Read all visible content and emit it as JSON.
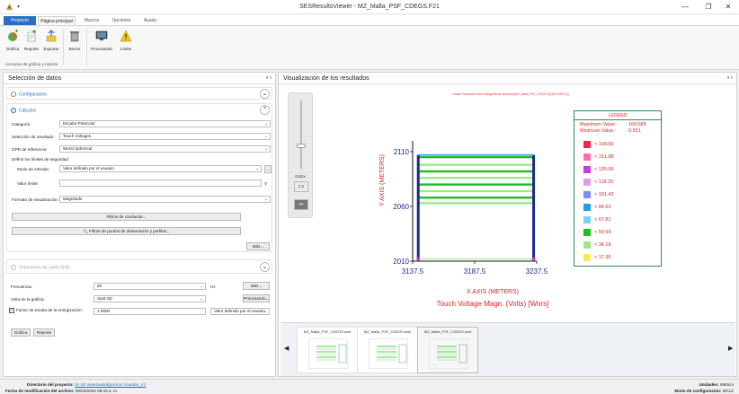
{
  "window": {
    "title": "SESResultsViewer - MZ_Malla_PSF_CDEGS.F21",
    "qa_label": "▾",
    "min": "—",
    "max": "❐",
    "close": "✕"
  },
  "tabs": [
    "Proyecto",
    "Página principal",
    "Macros",
    "Opciones",
    "Ayuda"
  ],
  "ribbon": {
    "buttons": [
      "Gráfica",
      "Reporte",
      "Exportar",
      "Borrar",
      "Procesando",
      "Límite"
    ],
    "group_label": "Acciones de gráfica y reporte"
  },
  "left": {
    "title": "Selección de datos",
    "pin": "▾ ⫰",
    "config_label": "Configuración",
    "calc_label": "Cálculos",
    "categoria_label": "Categoría",
    "categoria_value": "Escalar Potencial",
    "resultado_label": "Selección de resultado:",
    "resultado_value": "Touch Voltages",
    "gpr_label": "GPR de referencia:",
    "gpr_value": "Worst Spherical",
    "limites_label": "Definir los límites de seguridad",
    "modo_label": "Modo de entrada:",
    "modo_value": "Valor definido por el usuario",
    "modo_btn": "...",
    "valor_label": "Valor límite:",
    "valor_unit": "V",
    "formato_label": "Formato de visualización:",
    "formato_value": "Magnitude",
    "filtro_cond": "Filtros de conductor...",
    "filtro_obs": "Filtros de puntos de observación y perfiles...",
    "mas1": "Más...",
    "volumen_label": "Volúmenes de suelo finito",
    "frecuencia_label": "Frecuencia:",
    "frecuencia_value": "60",
    "frecuencia_unit": "Hz",
    "mas2": "Más...",
    "vista_label": "Vista de la gráfica:",
    "vista_value": "Spot-2D",
    "procesando": "Procesando...",
    "factor_label": "Factor de escala de la energización:",
    "factor_value": "1.0000",
    "factor_combo": "Valor definido por el usuario",
    "grafica_btn": "Gráfica",
    "reporte_btn": "Reporte"
  },
  "right": {
    "title": "Visualización de los resultados",
    "pin": "▾ ⫰",
    "zoom_value": "0.61x",
    "btn_11": "1:1",
    "btn_fit": "Fit",
    "thumbs": [
      "MZ_Malla_PSF_CDEGS.wmf",
      "MZ_Malla_PSF_CDEGS.wmf",
      "MZ_Malla_PSF_CDEGS.wmf"
    ],
    "prev": "◀",
    "next": "▶"
  },
  "chart_data": {
    "type": "heatmap",
    "title": "Scalar Potentials/Touch Voltage/Worst Spherical [MZ_Malla_PSF_CDEGS @(100.0000 %)]",
    "xlabel": "X AXIS  (METERS)",
    "subtitle": "Touch Voltage Magn. (Volts) [Wors]",
    "ylabel": "Y AXIS  (METERS)",
    "xticks": [
      "3137.5",
      "3187.5",
      "3237.5"
    ],
    "yticks": [
      "2110",
      "2060",
      "2010"
    ],
    "xlim": [
      3137.5,
      3237.5
    ],
    "ylim": [
      2010,
      2110
    ],
    "legend": {
      "title": "LEGEND",
      "max_label": "Maximum Value :",
      "max_value": "168.689",
      "min_label": "Minimum Value :",
      "min_value": "0.551",
      "entries": [
        {
          "value": "168.69",
          "color": "#ff1e50"
        },
        {
          "value": "151.88",
          "color": "#ff6fb0"
        },
        {
          "value": "135.06",
          "color": "#c43ce0"
        },
        {
          "value": "118.25",
          "color": "#e39be8"
        },
        {
          "value": "101.43",
          "color": "#7a8cf0"
        },
        {
          "value": "84.62",
          "color": "#1e9fe8"
        },
        {
          "value": "67.81",
          "color": "#78d2f0"
        },
        {
          "value": "50.99",
          "color": "#1ebe1e"
        },
        {
          "value": "34.18",
          "color": "#9fe88a"
        },
        {
          "value": "17.36",
          "color": "#f0f050"
        }
      ]
    }
  },
  "status": {
    "dir_label": "Directorio del proyecto:",
    "dir_value": "21-28 Venezuela\\Ejercicio Youtube_V1",
    "date_label": "Fecha de modificación del archivo:",
    "date_value": "09/03/2022 08:43 a. m.",
    "units_label": "Unidades:",
    "units_value": "Métrico",
    "mode_label": "Modo de configuración:",
    "mode_value": "MALZ"
  }
}
